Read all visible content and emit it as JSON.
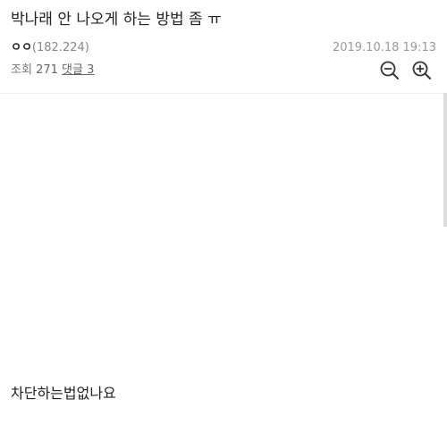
{
  "post": {
    "title": "박나래 안 나오게 하는 방법 좀 ㅠ",
    "author": "ㅇㅇ",
    "author_ip": "(182.224)",
    "date": "2019.10.18 19:13",
    "views_label": "조회",
    "views": "271",
    "comments_label": "댓글",
    "comments": "3",
    "body": "차단하는법없나요"
  },
  "icons": {
    "zoom_out": "zoom-out-icon",
    "zoom_in": "zoom-in-icon"
  },
  "colors": {
    "text": "#222222",
    "meta": "#888888",
    "date": "#999999",
    "divider": "#eeeeee"
  }
}
